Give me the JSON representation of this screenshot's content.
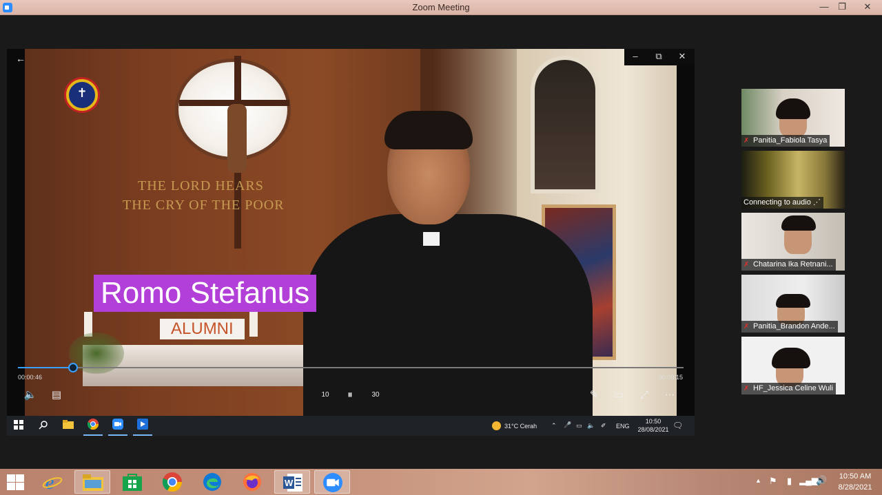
{
  "window": {
    "title": "Zoom Meeting",
    "minimize": "—",
    "maximize": "❐",
    "close": "✕"
  },
  "video": {
    "speaker_name": "Romo Stefanus",
    "speaker_role": "ALUMNI",
    "wall_text_line1": "THE LORD    HEARS",
    "wall_text_line2": "THE CRY OF   THE POOR"
  },
  "player": {
    "back": "←",
    "current_time": "00:00:46",
    "total_time": "00:09:15",
    "progress_fraction": 0.083,
    "minimize": "–",
    "restore": "⧉",
    "close": "✕",
    "volume_icon": "🔈",
    "subtitles_icon": "▤",
    "rewind_label": "10",
    "pause_icon": "⏸",
    "forward_label": "30",
    "edit_icon": "✎",
    "miniview_icon": "▭",
    "fullscreen_icon": "⤢",
    "more_icon": "⋯"
  },
  "inner_taskbar": {
    "weather": "31°C  Cerah",
    "language": "ENG",
    "time": "10:50",
    "date": "28/08/2021"
  },
  "participants": [
    {
      "name": "Panitia_Fabiola Tasya",
      "muted": true
    },
    {
      "name": "Connecting to audio ⋰",
      "muted": false
    },
    {
      "name": "Chatarina Ika Retnani...",
      "muted": true
    },
    {
      "name": "Panitia_Brandon Ande...",
      "muted": true
    },
    {
      "name": "HF_Jessica Celine Wuli",
      "muted": true
    }
  ],
  "taskbar": {
    "time": "10:50 AM",
    "date": "8/28/2021",
    "tray_caret": "▲"
  },
  "colors": {
    "name_banner": "#b23fd8",
    "role_text": "#c6542a",
    "seek_accent": "#3aa0ff",
    "mute_red": "#e0302c"
  }
}
